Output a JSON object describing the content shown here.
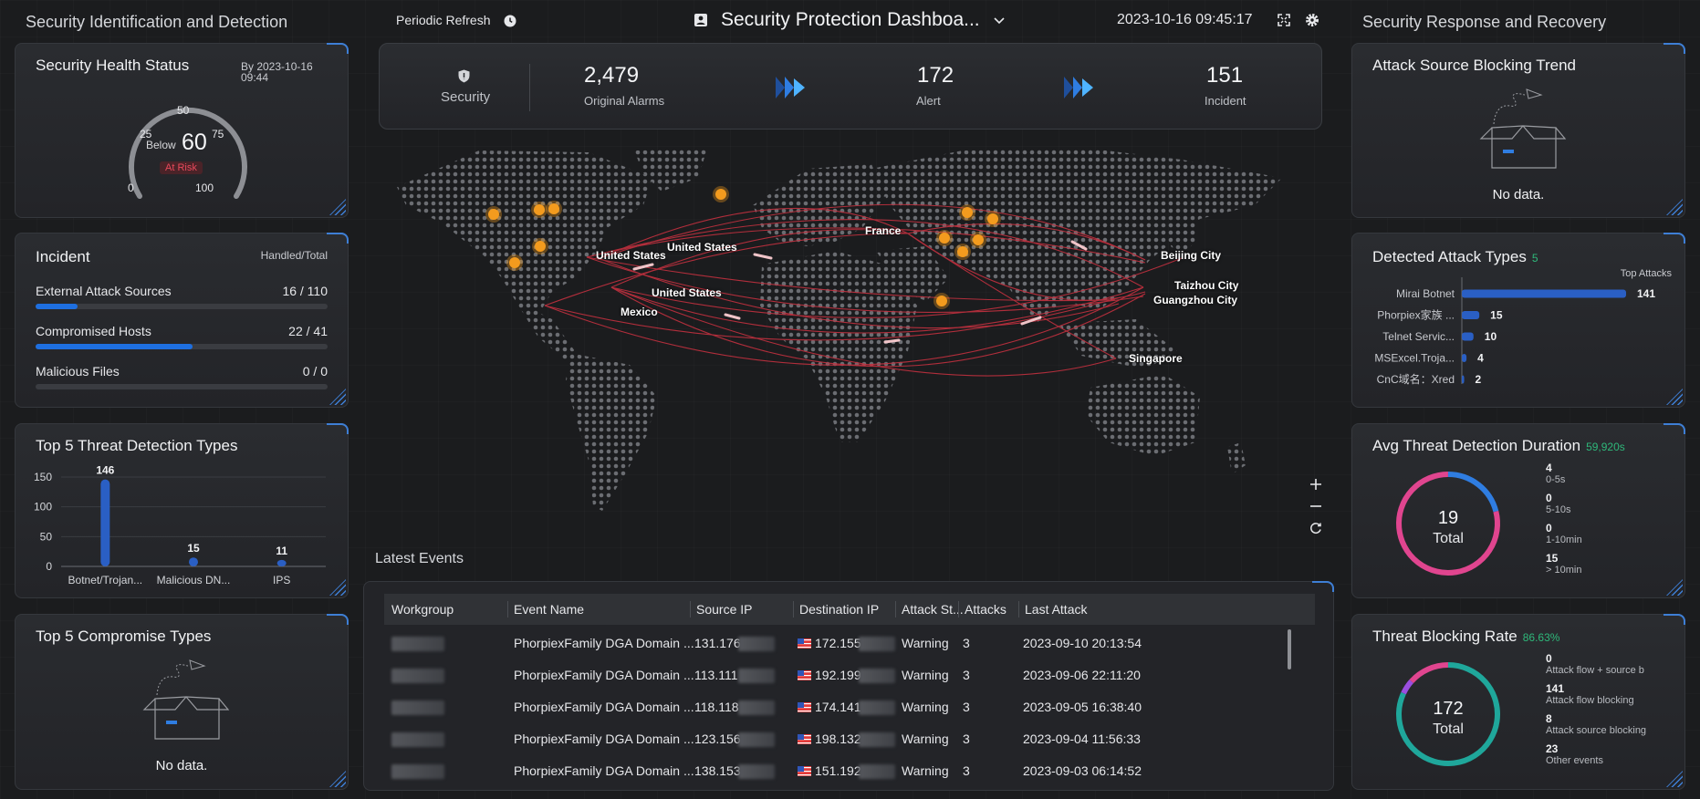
{
  "header": {
    "left_section": "Security Identification and Detection",
    "right_section": "Security Response and Recovery",
    "refresh_label": "Periodic Refresh",
    "dashboard_title": "Security Protection Dashboa...",
    "datetime": "2023-10-16 09:45:17"
  },
  "health": {
    "title": "Security Health Status",
    "date": "By 2023-10-16",
    "time": "09:44",
    "below": "Below",
    "score": "60",
    "status": "At Risk",
    "ticks": [
      "0",
      "25",
      "50",
      "75",
      "100"
    ],
    "level": 60
  },
  "incident": {
    "title": "Incident",
    "subtitle": "Handled/Total",
    "rows": [
      {
        "label": "External Attack Sources",
        "value": "16 / 110",
        "fraction": 0.145
      },
      {
        "label": "Compromised Hosts",
        "value": "22 / 41",
        "fraction": 0.537
      },
      {
        "label": "Malicious Files",
        "value": "0 / 0",
        "fraction": 0
      }
    ]
  },
  "threat_types": {
    "title": "Top 5 Threat Detection Types",
    "chart_data": {
      "type": "bar",
      "categories": [
        "Botnet/Trojan...",
        "Malicious DN...",
        "IPS"
      ],
      "values": [
        146,
        15,
        11
      ],
      "yticks": [
        "0",
        "50",
        "100",
        "150"
      ],
      "ylim": [
        0,
        150
      ]
    }
  },
  "compromise": {
    "title": "Top 5 Compromise Types",
    "empty": "No data."
  },
  "stats": {
    "security_label": "Security",
    "items": [
      {
        "value": "2,479",
        "label": "Original Alarms"
      },
      {
        "value": "172",
        "label": "Alert"
      },
      {
        "value": "151",
        "label": "Incident"
      }
    ]
  },
  "map": {
    "labels": [
      "United States",
      "United States",
      "United States",
      "Mexico",
      "France",
      "Beijing City",
      "Taizhou City",
      "Guangzhou City",
      "Singapore"
    ]
  },
  "events": {
    "title": "Latest Events",
    "columns": [
      "Workgroup",
      "Event Name",
      "Source IP",
      "Destination IP",
      "Attack St...",
      "Attacks",
      "Last Attack"
    ],
    "rows": [
      {
        "event": "PhorpiexFamily DGA Domain ...",
        "src": "131.176",
        "dst": "172.155.",
        "status": "Warning",
        "attacks": "3",
        "last": "2023-09-10 20:13:54"
      },
      {
        "event": "PhorpiexFamily DGA Domain ...",
        "src": "113.111",
        "dst": "192.199.",
        "status": "Warning",
        "attacks": "3",
        "last": "2023-09-06 22:11:20"
      },
      {
        "event": "PhorpiexFamily DGA Domain ...",
        "src": "118.118",
        "dst": "174.141.",
        "status": "Warning",
        "attacks": "3",
        "last": "2023-09-05 16:38:40"
      },
      {
        "event": "PhorpiexFamily DGA Domain ...",
        "src": "123.156",
        "dst": "198.132.",
        "status": "Warning",
        "attacks": "3",
        "last": "2023-09-04 11:56:33"
      },
      {
        "event": "PhorpiexFamily DGA Domain ...",
        "src": "138.153",
        "dst": "151.192.",
        "status": "Warning",
        "attacks": "3",
        "last": "2023-09-03 06:14:52"
      }
    ]
  },
  "blocking_trend": {
    "title": "Attack Source Blocking Trend",
    "empty": "No data."
  },
  "attack_types": {
    "title": "Detected Attack Types",
    "count": "5",
    "legend": "Top Attacks",
    "chart_data": {
      "type": "bar",
      "categories": [
        "Mirai Botnet",
        "Phorpiex家族 ...",
        "Telnet Servic...",
        "MSExcel.Troja...",
        "CnC域名：Xred"
      ],
      "values": [
        141,
        15,
        10,
        4,
        2
      ]
    }
  },
  "avg_duration": {
    "title": "Avg Threat Detection Duration",
    "value": "59,920s",
    "total": "19",
    "total_label": "Total",
    "legend": [
      {
        "count": "4",
        "label": "0-5s",
        "color": "#2f7de1"
      },
      {
        "count": "0",
        "label": "5-10s",
        "color": "#1fa79b"
      },
      {
        "count": "0",
        "label": "1-10min",
        "color": "#9a4fe0"
      },
      {
        "count": "15",
        "label": "> 10min",
        "color": "#e0458f"
      }
    ]
  },
  "blocking_rate": {
    "title": "Threat Blocking Rate",
    "value": "86.63%",
    "total": "172",
    "total_label": "Total",
    "legend": [
      {
        "count": "0",
        "label": "Attack flow + source b",
        "color": "#2f7de1"
      },
      {
        "count": "141",
        "label": "Attack flow blocking",
        "color": "#1fa79b"
      },
      {
        "count": "8",
        "label": "Attack source blocking",
        "color": "#9a4fe0"
      },
      {
        "count": "23",
        "label": "Other events",
        "color": "#e0458f"
      }
    ]
  }
}
